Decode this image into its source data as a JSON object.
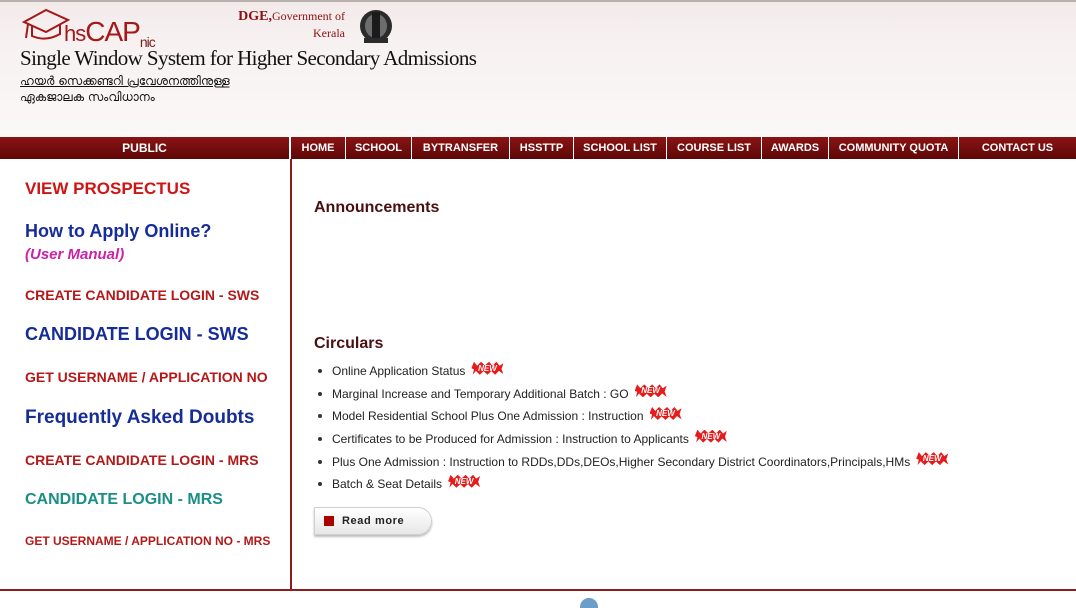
{
  "header": {
    "logo_hs": "hs",
    "logo_cap": "CAP",
    "logo_nic": "nic",
    "gov_bold": "DGE,",
    "gov_rest": "Government of",
    "gov_line2": "Kerala",
    "title": "Single Window System for Higher Secondary Admissions",
    "subtitle_ml_1": "ഹയർ സെക്കണ്ടറി പ്രവേശനത്തിനുള്ള",
    "subtitle_ml_2": "ഏകജാലക സംവിധാനം"
  },
  "nav": {
    "public_label": "PUBLIC",
    "items": [
      {
        "label": "HOME"
      },
      {
        "label": "SCHOOL"
      },
      {
        "label": "BYTRANSFER"
      },
      {
        "label": "HSSTTP"
      },
      {
        "label": "SCHOOL LIST"
      },
      {
        "label": "COURSE LIST"
      },
      {
        "label": "AWARDS"
      },
      {
        "label": "COMMUNITY QUOTA"
      },
      {
        "label": "CONTACT US"
      }
    ]
  },
  "sidebar": {
    "view_prospectus": "VIEW PROSPECTUS",
    "how_to_apply": "How to Apply Online?",
    "user_manual": "(User Manual)",
    "create_login_sws": "CREATE CANDIDATE LOGIN - SWS",
    "candidate_login_sws": "CANDIDATE LOGIN - SWS",
    "get_username": "GET USERNAME / APPLICATION NO",
    "faq": "Frequently Asked Doubts",
    "create_login_mrs": "CREATE CANDIDATE LOGIN - MRS",
    "candidate_login_mrs": "CANDIDATE LOGIN - MRS",
    "get_username_mrs": "GET USERNAME / APPLICATION NO - MRS"
  },
  "main": {
    "announcements_heading": "Announcements",
    "circulars_heading": "Circulars",
    "new_badge": "NEW",
    "circulars": [
      {
        "text": "Online Application Status"
      },
      {
        "text": "Marginal Increase and Temporary Additional Batch : GO"
      },
      {
        "text": "Model Residential School Plus One Admission : Instruction"
      },
      {
        "text": "Certificates to be Produced for Admission : Instruction to Applicants"
      },
      {
        "text": "Plus One Admission : Instruction to RDDs,DDs,DEOs,Higher Secondary District Coordinators,Principals,HMs"
      },
      {
        "text": "Batch & Seat Details"
      }
    ],
    "read_more": "Read more"
  },
  "colors": {
    "brand": "#8b1414",
    "nav_bg": "#6e0b0b",
    "link_red": "#b51818",
    "link_blue": "#162c98",
    "link_teal": "#1a8f86",
    "link_magenta": "#cc22aa"
  }
}
